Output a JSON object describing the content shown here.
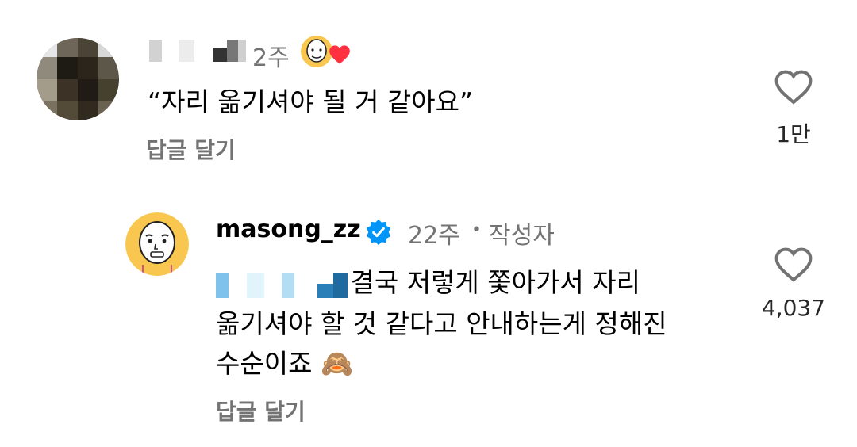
{
  "comments": [
    {
      "username": "",
      "time": "2주",
      "text": "“자리 옮기셔야 될 거 같아요”",
      "reply_label": "답글 달기",
      "like_count": "1만",
      "creator_liked": true,
      "username_redacted": true,
      "avatar_pixelated": true
    },
    {
      "username": "masong_zz",
      "verified": true,
      "time": "22주",
      "separator": "•",
      "badge": "작성자",
      "mention_redacted": true,
      "text_line1": "결국 저렇게 쫓아가서 자리",
      "text_line2": "옮기셔야 할 것 같다고 안내하는게 정해진",
      "text_line3": "수순이죠",
      "emoji": "🙈",
      "reply_label": "답글 달기",
      "like_count": "4,037"
    }
  ],
  "colors": {
    "muted": "#737373",
    "verified": "#0095f6",
    "heart_red": "#ff3040",
    "avatar_face_bg": "#f9c74f"
  }
}
